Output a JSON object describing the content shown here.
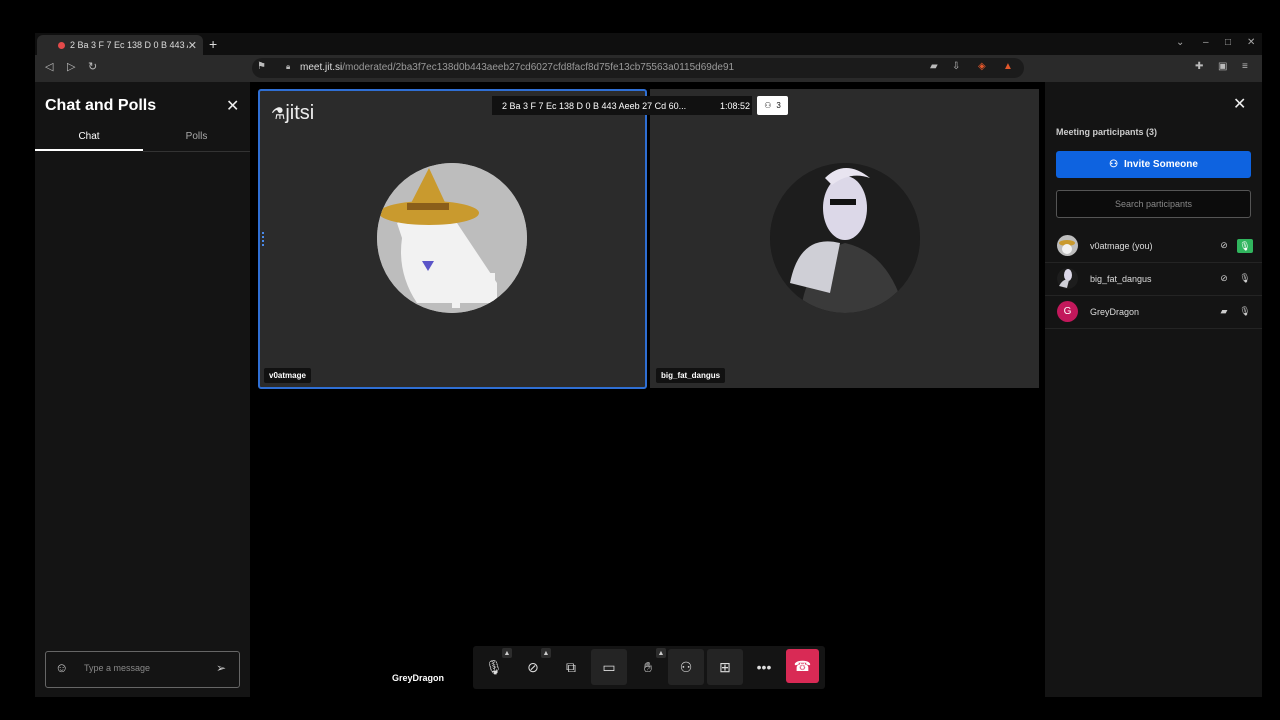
{
  "browser": {
    "tab_title": "2 Ba 3 F 7 Ec 138 D 0 B 443 A",
    "tab_close": "✕",
    "new_tab": "+",
    "url_host": "meet.jit.si",
    "url_path": "/moderated/2ba3f7ec138d0b443aeeb27cd6027cfd8facf8d75fe13cb75563a0115d69de91",
    "icons": [
      "back-icon",
      "forward-icon",
      "reload-icon",
      "bookmark-icon",
      "camera-icon",
      "install-icon",
      "brave-shield-icon",
      "rewards-icon",
      "extensions-icon",
      "wallet-icon",
      "menu-icon"
    ]
  },
  "chat": {
    "title": "Chat and Polls",
    "close": "✕",
    "tabs": [
      "Chat",
      "Polls"
    ],
    "input_placeholder": "Type a message"
  },
  "stage": {
    "logo_text": "jitsi",
    "subject": "2 Ba 3 F 7 Ec 138 D 0 B 443 Aeeb 27 Cd 60...",
    "timer": "1:08:52",
    "participant_count": "3",
    "tiles": [
      {
        "name": "v0atmage",
        "active": true
      },
      {
        "name": "big_fat_dangus",
        "active": false
      }
    ],
    "filmstrip_name": "GreyDragon"
  },
  "toolbox": {
    "buttons": [
      "microphone",
      "camera",
      "share-screen",
      "chat",
      "raise-hand",
      "participants",
      "tile-view",
      "more",
      "hangup"
    ]
  },
  "participants": {
    "title": "Meeting participants (3)",
    "invite_label": "Invite Someone",
    "search_placeholder": "Search participants",
    "close": "✕",
    "list": [
      {
        "name": "v0atmage (you)",
        "initial": "",
        "video": "off",
        "audio": "on"
      },
      {
        "name": "big_fat_dangus",
        "initial": "",
        "video": "off",
        "audio": "muted"
      },
      {
        "name": "GreyDragon",
        "initial": "G",
        "video": "on",
        "audio": "muted"
      }
    ]
  },
  "colors": {
    "accent": "#0e63e0",
    "active_border": "#2f6fd4",
    "hangup": "#d92a55",
    "mic_on": "#31b55e",
    "grey_dragon_avatar": "#c2185b"
  }
}
